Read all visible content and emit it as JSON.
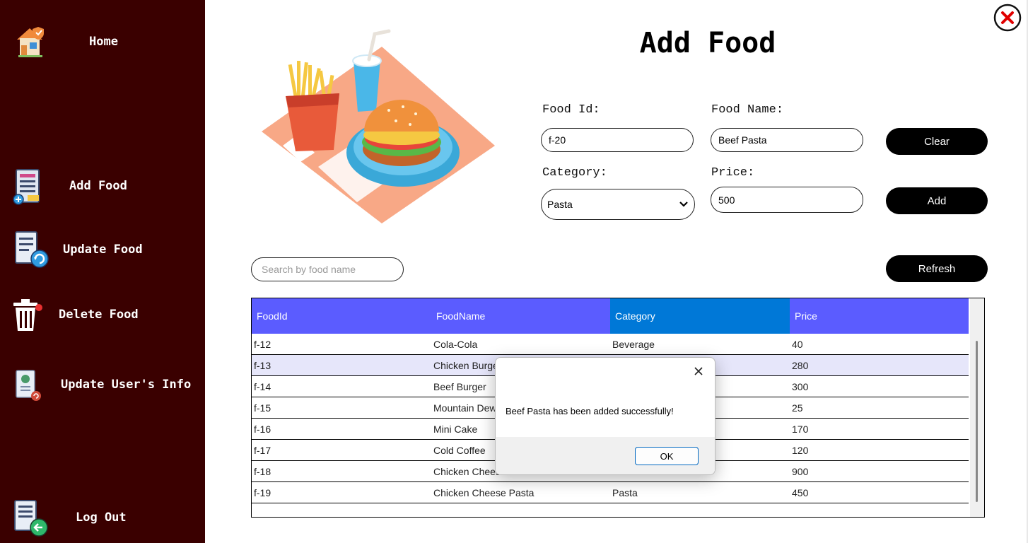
{
  "sidebar": {
    "items": [
      {
        "label": "Home",
        "icon": "home-icon"
      },
      {
        "label": "Add Food",
        "icon": "add-document-icon"
      },
      {
        "label": "Update Food",
        "icon": "update-document-icon"
      },
      {
        "label": "Delete Food",
        "icon": "trash-icon"
      },
      {
        "label": "Update User's Info",
        "icon": "user-card-icon"
      },
      {
        "label": "Log Out",
        "icon": "logout-document-icon"
      }
    ]
  },
  "header": {
    "title": "Add Food"
  },
  "form": {
    "food_id_label": "Food Id:",
    "food_id_value": "f-20",
    "food_name_label": "Food Name:",
    "food_name_value": "Beef Pasta",
    "category_label": "Category:",
    "category_value": "Pasta",
    "price_label": "Price:",
    "price_value": "500"
  },
  "buttons": {
    "clear": "Clear",
    "add": "Add",
    "refresh": "Refresh"
  },
  "search": {
    "placeholder": "Search by food name"
  },
  "table": {
    "columns": [
      "FoodId",
      "FoodName",
      "Category",
      "Price"
    ],
    "rows": [
      [
        "f-12",
        "Cola-Cola",
        "Beverage",
        "40"
      ],
      [
        "f-13",
        "Chicken Burge",
        "",
        "280"
      ],
      [
        "f-14",
        "Beef Burger",
        "",
        "300"
      ],
      [
        "f-15",
        "Mountain Dew",
        "",
        "25"
      ],
      [
        "f-16",
        "Mini Cake",
        "",
        "170"
      ],
      [
        "f-17",
        "Cold Coffee",
        "",
        "120"
      ],
      [
        "f-18",
        "Chicken Chees",
        "",
        "900"
      ],
      [
        "f-19",
        "Chicken Cheese Pasta",
        "Pasta",
        "450"
      ]
    ]
  },
  "dialog": {
    "message": "Beef Pasta has been added successfully!",
    "ok": "OK"
  },
  "colors": {
    "sidebar": "#3a0000",
    "header": "#5b5cff",
    "header_selected": "#0078d7",
    "row_selected": "#e6e6fa",
    "close": "#e00000"
  }
}
